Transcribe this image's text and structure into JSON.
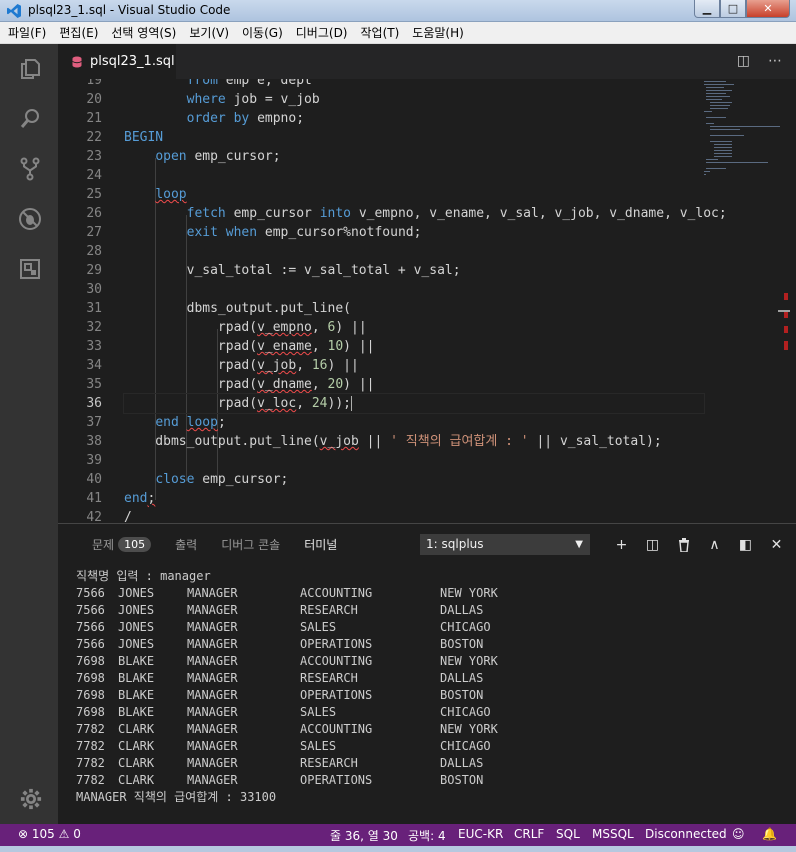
{
  "window": {
    "title": "plsql23_1.sql - Visual Studio Code",
    "min": "▁",
    "max": "□",
    "close": "✕"
  },
  "menu": [
    "파일(F)",
    "편집(E)",
    "선택 영역(S)",
    "보기(V)",
    "이동(G)",
    "디버그(D)",
    "작업(T)",
    "도움말(H)"
  ],
  "tab": {
    "name": "plsql23_1.sql",
    "close": "×"
  },
  "tab_actions": {
    "split": "◫",
    "more": "⋯"
  },
  "editor": {
    "line_numbers": [
      "19",
      "20",
      "21",
      "22",
      "23",
      "24",
      "25",
      "26",
      "27",
      "28",
      "29",
      "30",
      "31",
      "32",
      "33",
      "34",
      "35",
      "36",
      "37",
      "38",
      "39",
      "40",
      "41",
      "42"
    ],
    "current_line": "36"
  },
  "panel": {
    "tabs": [
      {
        "label": "문제",
        "badge": "105"
      },
      {
        "label": "출력"
      },
      {
        "label": "디버그 콘솔"
      },
      {
        "label": "터미널"
      }
    ],
    "terminal_select": "1: sqlplus",
    "actions": {
      "add": "+",
      "split": "◫",
      "trash": "🗑",
      "maximize": "∧",
      "layout": "◧",
      "close": "✕"
    }
  },
  "terminal": {
    "prompt": "직책명 입력 : manager",
    "rows": [
      [
        "7566",
        "JONES",
        "MANAGER",
        "ACCOUNTING",
        "NEW YORK"
      ],
      [
        "7566",
        "JONES",
        "MANAGER",
        "RESEARCH",
        "DALLAS"
      ],
      [
        "7566",
        "JONES",
        "MANAGER",
        "SALES",
        "CHICAGO"
      ],
      [
        "7566",
        "JONES",
        "MANAGER",
        "OPERATIONS",
        "BOSTON"
      ],
      [
        "7698",
        "BLAKE",
        "MANAGER",
        "ACCOUNTING",
        "NEW YORK"
      ],
      [
        "7698",
        "BLAKE",
        "MANAGER",
        "RESEARCH",
        "DALLAS"
      ],
      [
        "7698",
        "BLAKE",
        "MANAGER",
        "OPERATIONS",
        "BOSTON"
      ],
      [
        "7698",
        "BLAKE",
        "MANAGER",
        "SALES",
        "CHICAGO"
      ],
      [
        "7782",
        "CLARK",
        "MANAGER",
        "ACCOUNTING",
        "NEW YORK"
      ],
      [
        "7782",
        "CLARK",
        "MANAGER",
        "SALES",
        "CHICAGO"
      ],
      [
        "7782",
        "CLARK",
        "MANAGER",
        "RESEARCH",
        "DALLAS"
      ],
      [
        "7782",
        "CLARK",
        "MANAGER",
        "OPERATIONS",
        "BOSTON"
      ]
    ],
    "total": "MANAGER 직책의 급여합계 : 33100"
  },
  "status": {
    "errors": "105",
    "warnings": "0",
    "position": "줄 36, 열 30",
    "spaces": "공백: 4",
    "encoding": "EUC-KR",
    "eol": "CRLF",
    "language": "SQL",
    "dialect": "MSSQL",
    "connection": "Disconnected"
  },
  "colors": {
    "statusbar": "#68217a",
    "activitybar": "#333333",
    "editor_bg": "#1e1e1e",
    "keyword": "#569cd6",
    "string": "#ce9178",
    "number": "#b5cea8"
  }
}
